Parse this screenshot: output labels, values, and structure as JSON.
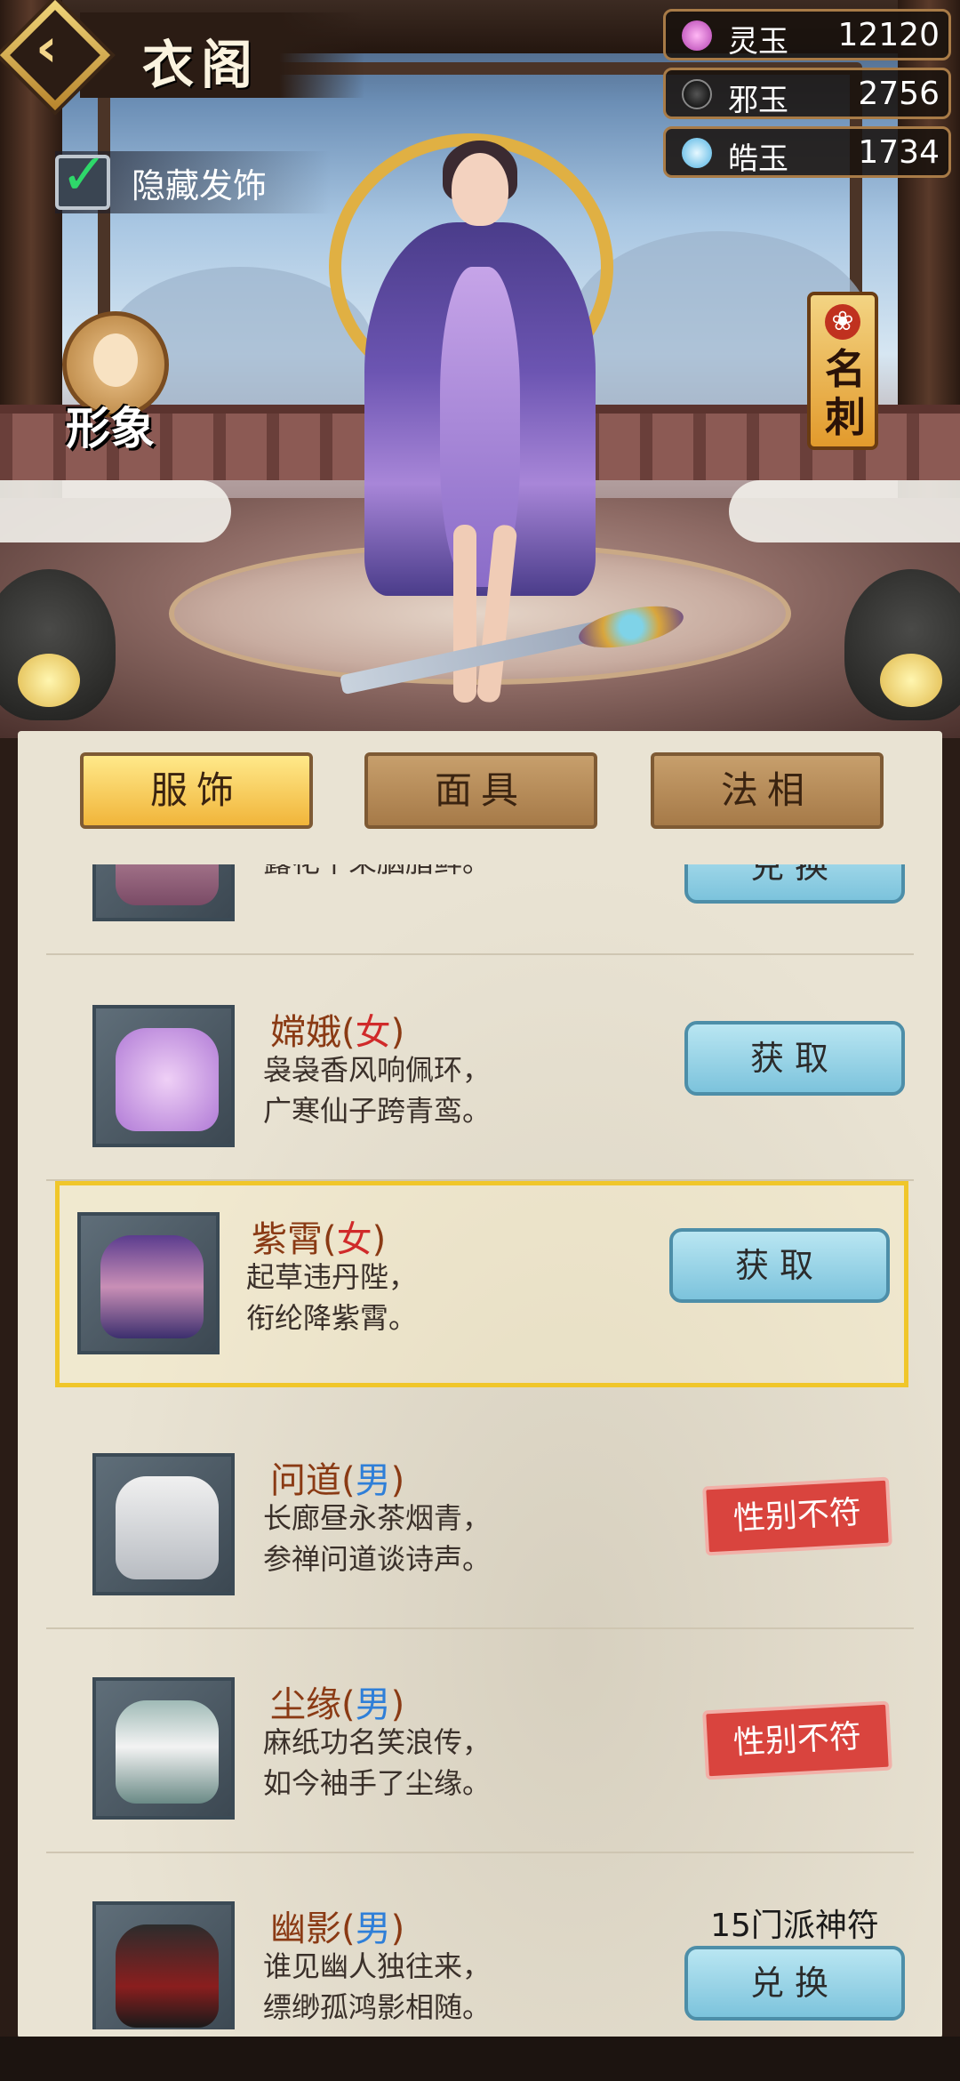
{
  "header": {
    "title": "衣阁"
  },
  "hide_hair": {
    "label": "隐藏发饰",
    "checked": true
  },
  "currencies": [
    {
      "name": "灵玉",
      "value": "12120",
      "color": "#e07ad8"
    },
    {
      "name": "邪玉",
      "value": "2756",
      "color": "#1a1a1a"
    },
    {
      "name": "皓玉",
      "value": "1734",
      "color": "#6cc8f0"
    }
  ],
  "side": {
    "appearance_label": "形象",
    "card_label": "名刺"
  },
  "tabs": [
    {
      "label": "服饰",
      "active": true
    },
    {
      "label": "面具",
      "active": false
    },
    {
      "label": "法相",
      "active": false
    }
  ],
  "items": [
    {
      "name": "",
      "gender": "",
      "desc1": "露花千朵胭脂鲜。",
      "desc2": "",
      "action": "兑换",
      "action_type": "blue",
      "cost": "",
      "selected": false
    },
    {
      "name": "嫦娥",
      "gender": "女",
      "desc1": "袅袅香风响佩环，",
      "desc2": "广寒仙子跨青鸾。",
      "action": "获取",
      "action_type": "blue",
      "cost": "",
      "selected": false
    },
    {
      "name": "紫霄",
      "gender": "女",
      "desc1": "起草违丹陛，",
      "desc2": "衔纶降紫霄。",
      "action": "获取",
      "action_type": "blue",
      "cost": "",
      "selected": true
    },
    {
      "name": "问道",
      "gender": "男",
      "desc1": "长廊昼永茶烟青，",
      "desc2": "参禅问道谈诗声。",
      "action": "性别不符",
      "action_type": "red",
      "cost": "",
      "selected": false
    },
    {
      "name": "尘缘",
      "gender": "男",
      "desc1": "麻纸功名笑浪传，",
      "desc2": "如今袖手了尘缘。",
      "action": "性别不符",
      "action_type": "red",
      "cost": "",
      "selected": false
    },
    {
      "name": "幽影",
      "gender": "男",
      "desc1": "谁见幽人独往来，",
      "desc2": "缥缈孤鸿影相随。",
      "action": "兑换",
      "action_type": "blue",
      "cost": "15门派神符",
      "selected": false
    }
  ]
}
